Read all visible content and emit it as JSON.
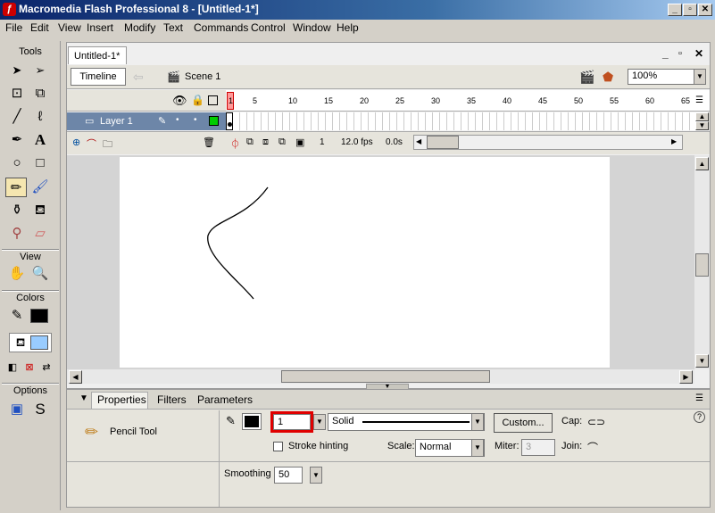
{
  "window": {
    "title": "Macromedia Flash Professional 8 - [Untitled-1*]",
    "min": "_",
    "max": "▫",
    "close": "✕"
  },
  "menu": [
    "File",
    "Edit",
    "View",
    "Insert",
    "Modify",
    "Text",
    "Commands",
    "Control",
    "Window",
    "Help"
  ],
  "tools": {
    "title": "Tools",
    "view": "View",
    "colors": "Colors",
    "options": "Options"
  },
  "document": {
    "tab": "Untitled-1*",
    "timeline_button": "Timeline",
    "scene": "Scene 1",
    "zoom": "100%"
  },
  "timeline": {
    "layer": "Layer 1",
    "frame_numbers": [
      "1",
      "5",
      "10",
      "15",
      "20",
      "25",
      "30",
      "35",
      "40",
      "45",
      "50",
      "55",
      "60",
      "65"
    ],
    "current_frame": "1",
    "fps": "12.0 fps",
    "elapsed": "0.0s"
  },
  "properties": {
    "tabs": [
      "Properties",
      "Filters",
      "Parameters"
    ],
    "tool_name": "Pencil Tool",
    "stroke_height": "1",
    "stroke_style": "Solid",
    "custom_button": "Custom...",
    "cap_label": "Cap:",
    "stroke_hinting": "Stroke hinting",
    "scale_label": "Scale:",
    "scale_value": "Normal",
    "miter_label": "Miter:",
    "miter_value": "3",
    "join_label": "Join:",
    "smoothing_label": "Smoothing",
    "smoothing_value": "50",
    "help": "?"
  },
  "colors": {
    "highlight": "#e00000",
    "titlebar": "#0a246a",
    "stroke": "#000000",
    "fill": "#99ccff"
  }
}
